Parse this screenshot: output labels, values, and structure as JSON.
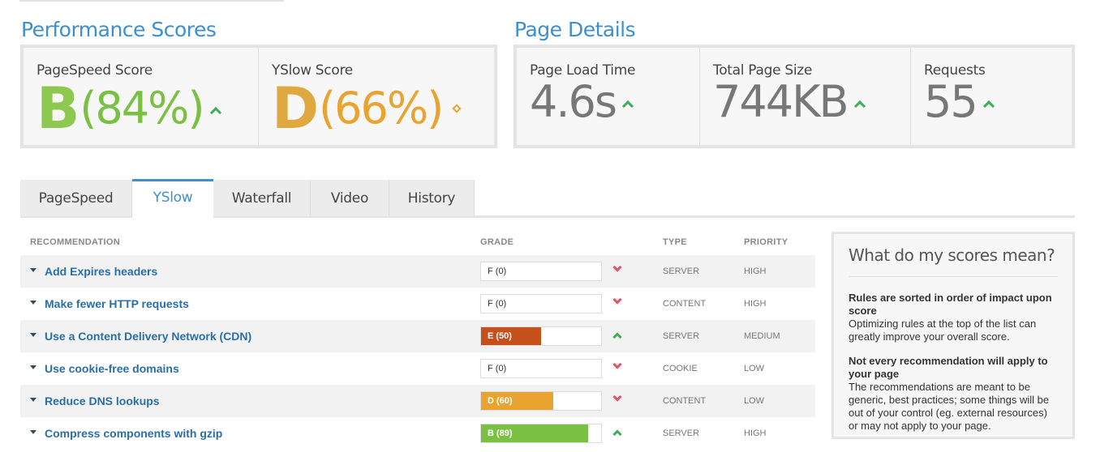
{
  "performance": {
    "title": "Performance Scores",
    "pagespeed": {
      "label": "PageSpeed Score",
      "grade": "B",
      "percent": "(84%)",
      "color": "#7ac143",
      "trend": "up"
    },
    "yslow": {
      "label": "YSlow Score",
      "grade": "D",
      "percent": "(66%)",
      "color": "#e8a330",
      "trend": "same"
    }
  },
  "details": {
    "title": "Page Details",
    "load_time": {
      "label": "Page Load Time",
      "value": "4.6s"
    },
    "page_size": {
      "label": "Total Page Size",
      "value": "744KB"
    },
    "requests": {
      "label": "Requests",
      "value": "55"
    }
  },
  "tabs": [
    {
      "label": "PageSpeed",
      "active": false
    },
    {
      "label": "YSlow",
      "active": true
    },
    {
      "label": "Waterfall",
      "active": false
    },
    {
      "label": "Video",
      "active": false
    },
    {
      "label": "History",
      "active": false
    }
  ],
  "table": {
    "headers": {
      "recommendation": "RECOMMENDATION",
      "grade": "GRADE",
      "type": "TYPE",
      "priority": "PRIORITY"
    },
    "rows": [
      {
        "label": "Add Expires headers",
        "grade": "F (0)",
        "score": 0,
        "color": "#ffffff",
        "trend": "down",
        "type": "SERVER",
        "priority": "HIGH"
      },
      {
        "label": "Make fewer HTTP requests",
        "grade": "F (0)",
        "score": 0,
        "color": "#ffffff",
        "trend": "down",
        "type": "CONTENT",
        "priority": "HIGH"
      },
      {
        "label": "Use a Content Delivery Network (CDN)",
        "grade": "E (50)",
        "score": 50,
        "color": "#c6501c",
        "trend": "up",
        "type": "SERVER",
        "priority": "MEDIUM"
      },
      {
        "label": "Use cookie-free domains",
        "grade": "F (0)",
        "score": 0,
        "color": "#ffffff",
        "trend": "down",
        "type": "COOKIE",
        "priority": "LOW"
      },
      {
        "label": "Reduce DNS lookups",
        "grade": "D (60)",
        "score": 60,
        "color": "#e8a330",
        "trend": "down",
        "type": "CONTENT",
        "priority": "LOW"
      },
      {
        "label": "Compress components with gzip",
        "grade": "B (89)",
        "score": 89,
        "color": "#7ac143",
        "trend": "up",
        "type": "SERVER",
        "priority": "HIGH"
      }
    ]
  },
  "help": {
    "title": "What do my scores mean?",
    "sections": [
      {
        "heading": "Rules are sorted in order of impact upon score",
        "body": "Optimizing rules at the top of the list can greatly improve your overall score."
      },
      {
        "heading": "Not every recommendation will apply to your page",
        "body": "The recommendations are meant to be generic, best practices; some things will be out of your control (eg. external resources) or may not apply to your page."
      }
    ]
  }
}
